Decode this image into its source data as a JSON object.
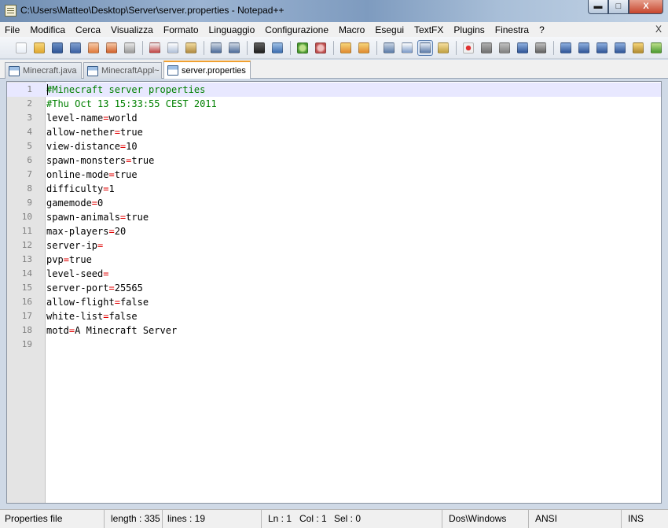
{
  "window": {
    "title": "C:\\Users\\Matteo\\Desktop\\Server\\server.properties - Notepad++",
    "minimize_label": "▬",
    "maximize_label": "□",
    "close_label": "X"
  },
  "menu": {
    "items": [
      "File",
      "Modifica",
      "Cerca",
      "Visualizza",
      "Formato",
      "Linguaggio",
      "Configurazione",
      "Macro",
      "Esegui",
      "TextFX",
      "Plugins",
      "Finestra",
      "?"
    ],
    "close_doc_label": "X"
  },
  "toolbar": {
    "icons": [
      "new-file-icon",
      "open-file-icon",
      "save-icon",
      "save-all-icon",
      "close-icon",
      "close-all-icon",
      "print-icon",
      "cut-icon",
      "copy-icon",
      "paste-icon",
      "undo-icon",
      "redo-icon",
      "find-icon",
      "replace-icon",
      "zoom-in-icon",
      "zoom-out-icon",
      "sync-vertical-icon",
      "sync-horizontal-icon",
      "word-wrap-icon",
      "show-all-chars-icon",
      "indent-guide-icon",
      "doc-map-icon",
      "record-macro-icon",
      "stop-record-icon",
      "play-macro-icon",
      "run-macro-multiple-icon",
      "save-macro-icon",
      "textfx-icon",
      "up-icon",
      "down-icon",
      "down-alt-icon",
      "spell-check-icon",
      "abc-check-icon"
    ]
  },
  "tabs": [
    {
      "label": "Minecraft.java",
      "active": false
    },
    {
      "label": "MinecraftAppl~",
      "active": false
    },
    {
      "label": "server.properties",
      "active": true
    }
  ],
  "editor": {
    "lines": [
      {
        "n": "1",
        "comment": "#Minecraft server properties",
        "key": "",
        "eq": "",
        "val": ""
      },
      {
        "n": "2",
        "comment": "#Thu Oct 13 15:33:55 CEST 2011",
        "key": "",
        "eq": "",
        "val": ""
      },
      {
        "n": "3",
        "comment": "",
        "key": "level-name",
        "eq": "=",
        "val": "world"
      },
      {
        "n": "4",
        "comment": "",
        "key": "allow-nether",
        "eq": "=",
        "val": "true"
      },
      {
        "n": "5",
        "comment": "",
        "key": "view-distance",
        "eq": "=",
        "val": "10"
      },
      {
        "n": "6",
        "comment": "",
        "key": "spawn-monsters",
        "eq": "=",
        "val": "true"
      },
      {
        "n": "7",
        "comment": "",
        "key": "online-mode",
        "eq": "=",
        "val": "true"
      },
      {
        "n": "8",
        "comment": "",
        "key": "difficulty",
        "eq": "=",
        "val": "1"
      },
      {
        "n": "9",
        "comment": "",
        "key": "gamemode",
        "eq": "=",
        "val": "0"
      },
      {
        "n": "10",
        "comment": "",
        "key": "spawn-animals",
        "eq": "=",
        "val": "true"
      },
      {
        "n": "11",
        "comment": "",
        "key": "max-players",
        "eq": "=",
        "val": "20"
      },
      {
        "n": "12",
        "comment": "",
        "key": "server-ip",
        "eq": "=",
        "val": ""
      },
      {
        "n": "13",
        "comment": "",
        "key": "pvp",
        "eq": "=",
        "val": "true"
      },
      {
        "n": "14",
        "comment": "",
        "key": "level-seed",
        "eq": "=",
        "val": ""
      },
      {
        "n": "15",
        "comment": "",
        "key": "server-port",
        "eq": "=",
        "val": "25565"
      },
      {
        "n": "16",
        "comment": "",
        "key": "allow-flight",
        "eq": "=",
        "val": "false"
      },
      {
        "n": "17",
        "comment": "",
        "key": "white-list",
        "eq": "=",
        "val": "false"
      },
      {
        "n": "18",
        "comment": "",
        "key": "motd",
        "eq": "=",
        "val": "A Minecraft Server"
      },
      {
        "n": "19",
        "comment": "",
        "key": "",
        "eq": "",
        "val": ""
      }
    ]
  },
  "status": {
    "file_type": "Properties file",
    "length": "length : 335",
    "lines": "lines : 19",
    "ln": "Ln : 1",
    "col": "Col : 1",
    "sel": "Sel : 0",
    "eol": "Dos\\Windows",
    "encoding": "ANSI",
    "mode": "INS"
  },
  "colors": {
    "comment": "#008000",
    "operator": "#e00000",
    "current_line": "#e8e8ff",
    "active_tab_accent": "#f0a030"
  }
}
